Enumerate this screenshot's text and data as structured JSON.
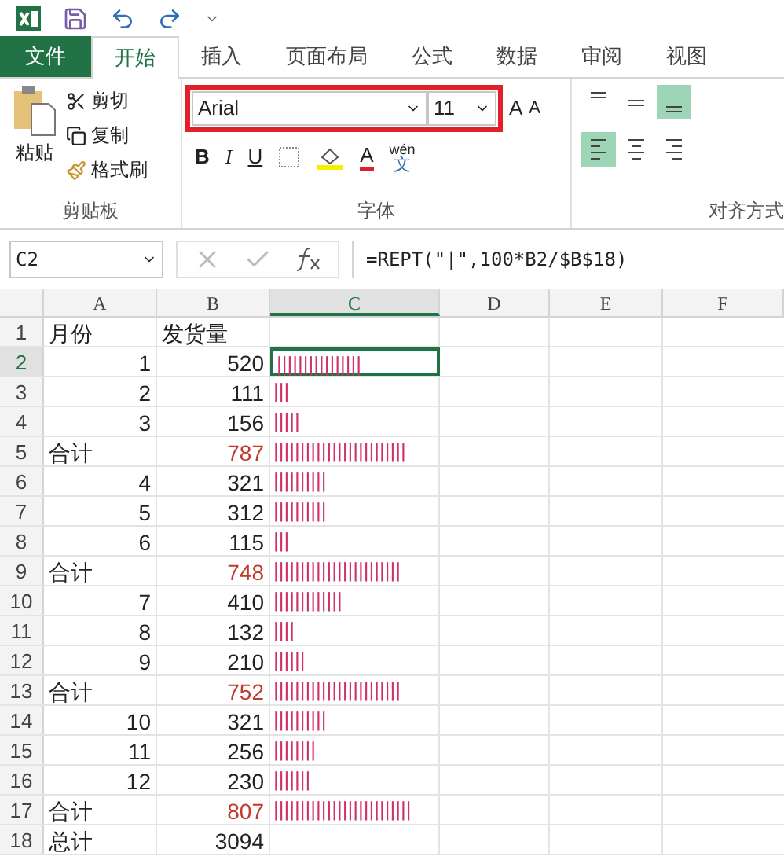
{
  "tabs": [
    {
      "label": "文件",
      "kind": "file"
    },
    {
      "label": "开始",
      "kind": "tab",
      "selected": true
    },
    {
      "label": "插入",
      "kind": "tab",
      "selected": false
    },
    {
      "label": "页面布局",
      "kind": "tab",
      "selected": false
    },
    {
      "label": "公式",
      "kind": "tab",
      "selected": false
    },
    {
      "label": "数据",
      "kind": "tab",
      "selected": false
    },
    {
      "label": "审阅",
      "kind": "tab",
      "selected": false
    },
    {
      "label": "视图",
      "kind": "tab",
      "selected": false
    }
  ],
  "clipboard": {
    "paste": "粘贴",
    "items": [
      "剪切",
      "复制",
      "格式刷"
    ],
    "label": "剪贴板"
  },
  "font": {
    "name": "Arial",
    "size": "11",
    "grow": "A",
    "shrink": "A",
    "bold": "B",
    "italic": "I",
    "underline": "U",
    "color_letter": "A",
    "phonetic_top": "wén",
    "phonetic_bottom": "文",
    "label": "字体"
  },
  "alignment": {
    "label": "对齐方式",
    "vertical": [
      {
        "kind": "top",
        "selected": false
      },
      {
        "kind": "middle",
        "selected": false
      },
      {
        "kind": "bottom",
        "selected": true
      }
    ],
    "horizontal": [
      {
        "kind": "left",
        "selected": true
      },
      {
        "kind": "center",
        "selected": false
      },
      {
        "kind": "right",
        "selected": false
      }
    ]
  },
  "formula_bar": {
    "name_box": "C2",
    "formula": "=REPT(\"|\",100*B2/$B$18)"
  },
  "columns": [
    {
      "label": "A",
      "selected": false
    },
    {
      "label": "B",
      "selected": false
    },
    {
      "label": "C",
      "selected": true
    },
    {
      "label": "D",
      "selected": false
    },
    {
      "label": "E",
      "selected": false
    },
    {
      "label": "F",
      "selected": false
    }
  ],
  "rows": [
    {
      "number": "1",
      "selected": false,
      "a": "月份",
      "b": "发货量",
      "c": "",
      "kind": "header"
    },
    {
      "number": "2",
      "selected": true,
      "a": "1",
      "b": "520",
      "c": "||||||||||||||||",
      "kind": "month"
    },
    {
      "number": "3",
      "selected": false,
      "a": "2",
      "b": "111",
      "c": "|||",
      "kind": "month"
    },
    {
      "number": "4",
      "selected": false,
      "a": "3",
      "b": "156",
      "c": "|||||",
      "kind": "month"
    },
    {
      "number": "5",
      "selected": false,
      "a": "合计",
      "b": "787",
      "c": "|||||||||||||||||||||||||",
      "kind": "subtotal"
    },
    {
      "number": "6",
      "selected": false,
      "a": "4",
      "b": "321",
      "c": "||||||||||",
      "kind": "month"
    },
    {
      "number": "7",
      "selected": false,
      "a": "5",
      "b": "312",
      "c": "||||||||||",
      "kind": "month"
    },
    {
      "number": "8",
      "selected": false,
      "a": "6",
      "b": "115",
      "c": "|||",
      "kind": "month"
    },
    {
      "number": "9",
      "selected": false,
      "a": "合计",
      "b": "748",
      "c": "||||||||||||||||||||||||",
      "kind": "subtotal"
    },
    {
      "number": "10",
      "selected": false,
      "a": "7",
      "b": "410",
      "c": "|||||||||||||",
      "kind": "month"
    },
    {
      "number": "11",
      "selected": false,
      "a": "8",
      "b": "132",
      "c": "||||",
      "kind": "month"
    },
    {
      "number": "12",
      "selected": false,
      "a": "9",
      "b": "210",
      "c": "||||||",
      "kind": "month"
    },
    {
      "number": "13",
      "selected": false,
      "a": "合计",
      "b": "752",
      "c": "||||||||||||||||||||||||",
      "kind": "subtotal"
    },
    {
      "number": "14",
      "selected": false,
      "a": "10",
      "b": "321",
      "c": "||||||||||",
      "kind": "month"
    },
    {
      "number": "15",
      "selected": false,
      "a": "11",
      "b": "256",
      "c": "||||||||",
      "kind": "month"
    },
    {
      "number": "16",
      "selected": false,
      "a": "12",
      "b": "230",
      "c": "|||||||",
      "kind": "month"
    },
    {
      "number": "17",
      "selected": false,
      "a": "合计",
      "b": "807",
      "c": "||||||||||||||||||||||||||",
      "kind": "subtotal"
    },
    {
      "number": "18",
      "selected": false,
      "a": "总计",
      "b": "3094",
      "c": "",
      "kind": "grand"
    }
  ]
}
